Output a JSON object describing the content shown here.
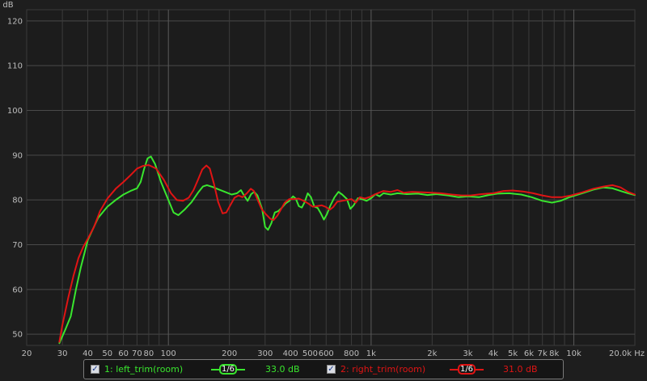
{
  "chart_data": {
    "type": "line",
    "ylabel": "dB",
    "x_unit": "Hz",
    "xscale": "log",
    "xlim": [
      20,
      20000
    ],
    "ylim": [
      47.5,
      122.5
    ],
    "grid": true,
    "yticks": [
      50,
      60,
      70,
      80,
      90,
      100,
      110,
      120
    ],
    "ytick_labels": [
      "50",
      "60",
      "70",
      "80",
      "90",
      "100",
      "110",
      "120"
    ],
    "xticks": [
      20,
      30,
      40,
      50,
      60,
      70,
      80,
      100,
      200,
      300,
      400,
      500,
      600,
      800,
      1000,
      2000,
      3000,
      4000,
      5000,
      6000,
      7000,
      8000,
      10000,
      20000
    ],
    "xtick_labels": [
      "20",
      "30",
      "40",
      "50",
      "60",
      "70",
      "80",
      "100",
      "200",
      "300",
      "400",
      "500",
      "600",
      "800",
      "1k",
      "2k",
      "3k",
      "4k",
      "5k",
      "6k",
      "7k",
      "8k",
      "10k",
      "20.0k Hz"
    ],
    "series": [
      {
        "name": "1: left_trim(room)",
        "color": "#39e62e",
        "points": [
          [
            29,
            48
          ],
          [
            31,
            51
          ],
          [
            33,
            54
          ],
          [
            35,
            60
          ],
          [
            37,
            65
          ],
          [
            40,
            71
          ],
          [
            45,
            76
          ],
          [
            50,
            78.5
          ],
          [
            55,
            80
          ],
          [
            60,
            81.2
          ],
          [
            65,
            82
          ],
          [
            70,
            82.6
          ],
          [
            73,
            84
          ],
          [
            76,
            87
          ],
          [
            79,
            89.3
          ],
          [
            82,
            89.7
          ],
          [
            86,
            88
          ],
          [
            92,
            84
          ],
          [
            100,
            80
          ],
          [
            106,
            77.2
          ],
          [
            112,
            76.6
          ],
          [
            120,
            77.8
          ],
          [
            130,
            79.5
          ],
          [
            140,
            81.6
          ],
          [
            148,
            83
          ],
          [
            155,
            83.3
          ],
          [
            165,
            82.9
          ],
          [
            178,
            82.3
          ],
          [
            190,
            81.8
          ],
          [
            205,
            81.2
          ],
          [
            218,
            81.5
          ],
          [
            228,
            82.2
          ],
          [
            236,
            81
          ],
          [
            246,
            79.8
          ],
          [
            256,
            81.3
          ],
          [
            265,
            81.8
          ],
          [
            275,
            81
          ],
          [
            290,
            78
          ],
          [
            300,
            74
          ],
          [
            310,
            73.3
          ],
          [
            322,
            74.8
          ],
          [
            335,
            77.2
          ],
          [
            348,
            77.5
          ],
          [
            362,
            78.2
          ],
          [
            378,
            79.2
          ],
          [
            395,
            79.8
          ],
          [
            412,
            80.8
          ],
          [
            425,
            80.3
          ],
          [
            440,
            78.6
          ],
          [
            455,
            78.3
          ],
          [
            470,
            79.5
          ],
          [
            487,
            81.5
          ],
          [
            505,
            80.6
          ],
          [
            525,
            78.5
          ],
          [
            545,
            78.2
          ],
          [
            565,
            77
          ],
          [
            585,
            75.6
          ],
          [
            605,
            76.8
          ],
          [
            630,
            78.8
          ],
          [
            660,
            80.6
          ],
          [
            690,
            81.8
          ],
          [
            720,
            81.2
          ],
          [
            760,
            80.2
          ],
          [
            790,
            78
          ],
          [
            820,
            78.8
          ],
          [
            860,
            80.4
          ],
          [
            900,
            80.2
          ],
          [
            950,
            79.8
          ],
          [
            1000,
            80.4
          ],
          [
            1050,
            81.3
          ],
          [
            1100,
            80.8
          ],
          [
            1150,
            81.5
          ],
          [
            1250,
            81.2
          ],
          [
            1350,
            81.5
          ],
          [
            1500,
            81.3
          ],
          [
            1700,
            81.4
          ],
          [
            1900,
            81.1
          ],
          [
            2100,
            81.3
          ],
          [
            2400,
            81
          ],
          [
            2700,
            80.6
          ],
          [
            3000,
            80.8
          ],
          [
            3400,
            80.6
          ],
          [
            3800,
            81.1
          ],
          [
            4200,
            81.4
          ],
          [
            4800,
            81.5
          ],
          [
            5500,
            81.2
          ],
          [
            6200,
            80.6
          ],
          [
            7000,
            79.8
          ],
          [
            7800,
            79.4
          ],
          [
            8600,
            79.8
          ],
          [
            9500,
            80.6
          ],
          [
            11000,
            81.5
          ],
          [
            12500,
            82.3
          ],
          [
            14000,
            82.8
          ],
          [
            15500,
            82.6
          ],
          [
            17000,
            82
          ],
          [
            18500,
            81.5
          ],
          [
            20000,
            81.1
          ]
        ]
      },
      {
        "name": "2: right_trim(room)",
        "color": "#e01414",
        "points": [
          [
            29,
            48.3
          ],
          [
            30,
            52
          ],
          [
            32,
            58
          ],
          [
            34,
            63
          ],
          [
            36,
            67
          ],
          [
            38,
            69.5
          ],
          [
            40,
            71.3
          ],
          [
            43,
            74
          ],
          [
            46,
            77.5
          ],
          [
            50,
            80.3
          ],
          [
            55,
            82.5
          ],
          [
            60,
            84
          ],
          [
            65,
            85.5
          ],
          [
            70,
            87
          ],
          [
            75,
            87.6
          ],
          [
            80,
            87.8
          ],
          [
            87,
            87
          ],
          [
            95,
            84.5
          ],
          [
            103,
            81.5
          ],
          [
            110,
            80
          ],
          [
            118,
            79.8
          ],
          [
            126,
            80.5
          ],
          [
            133,
            82.2
          ],
          [
            140,
            84.5
          ],
          [
            147,
            86.8
          ],
          [
            154,
            87.7
          ],
          [
            160,
            87
          ],
          [
            168,
            83.5
          ],
          [
            176,
            79.5
          ],
          [
            185,
            77
          ],
          [
            193,
            77.2
          ],
          [
            202,
            78.8
          ],
          [
            212,
            80.5
          ],
          [
            222,
            81
          ],
          [
            232,
            80.6
          ],
          [
            244,
            81.5
          ],
          [
            255,
            82.5
          ],
          [
            264,
            82
          ],
          [
            276,
            80
          ],
          [
            288,
            78
          ],
          [
            300,
            77
          ],
          [
            318,
            75.8
          ],
          [
            330,
            75.5
          ],
          [
            345,
            76.5
          ],
          [
            360,
            78
          ],
          [
            375,
            79.4
          ],
          [
            395,
            80.2
          ],
          [
            415,
            80.2
          ],
          [
            440,
            80.3
          ],
          [
            465,
            79.8
          ],
          [
            490,
            79.2
          ],
          [
            515,
            78.5
          ],
          [
            540,
            78.6
          ],
          [
            570,
            78.8
          ],
          [
            600,
            78.4
          ],
          [
            625,
            77.8
          ],
          [
            650,
            78.4
          ],
          [
            680,
            79.6
          ],
          [
            720,
            79.8
          ],
          [
            760,
            80
          ],
          [
            800,
            80.2
          ],
          [
            840,
            79.4
          ],
          [
            880,
            80.6
          ],
          [
            930,
            80.3
          ],
          [
            990,
            80.7
          ],
          [
            1040,
            81.2
          ],
          [
            1090,
            81.6
          ],
          [
            1150,
            82
          ],
          [
            1250,
            81.8
          ],
          [
            1350,
            82.2
          ],
          [
            1450,
            81.6
          ],
          [
            1600,
            81.8
          ],
          [
            1800,
            81.7
          ],
          [
            2000,
            81.6
          ],
          [
            2200,
            81.5
          ],
          [
            2500,
            81.2
          ],
          [
            2800,
            81
          ],
          [
            3100,
            81
          ],
          [
            3500,
            81.3
          ],
          [
            4000,
            81.5
          ],
          [
            4500,
            82
          ],
          [
            5000,
            82.1
          ],
          [
            5600,
            81.9
          ],
          [
            6300,
            81.5
          ],
          [
            7000,
            81
          ],
          [
            7800,
            80.6
          ],
          [
            8700,
            80.6
          ],
          [
            9700,
            81
          ],
          [
            11000,
            81.7
          ],
          [
            12500,
            82.5
          ],
          [
            14000,
            83
          ],
          [
            15500,
            83.3
          ],
          [
            17000,
            82.8
          ],
          [
            18500,
            81.8
          ],
          [
            20000,
            81.2
          ]
        ]
      }
    ]
  },
  "legend": {
    "items": [
      {
        "checked_glyph": "✓",
        "label": "1: left_trim(room)",
        "color": "#39e62e",
        "smoothing": "1/6",
        "level": "33.0 dB"
      },
      {
        "checked_glyph": "✓",
        "label": "2: right_trim(room)",
        "color": "#e01414",
        "smoothing": "1/6",
        "level": "31.0 dB"
      }
    ]
  }
}
